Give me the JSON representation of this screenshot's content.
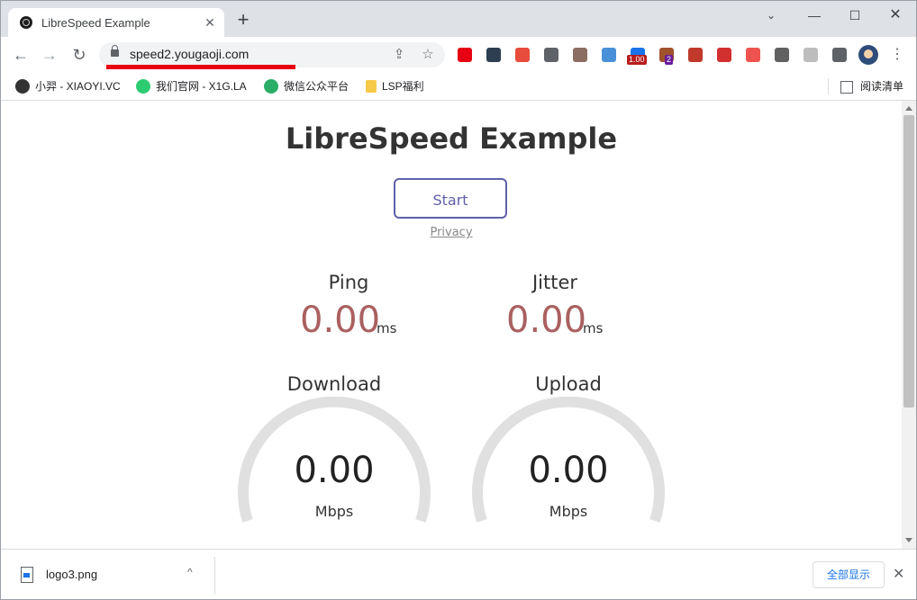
{
  "browser": {
    "tab_title": "LibreSpeed Example",
    "tab_close": "✕",
    "new_tab": "+",
    "tab_search": "⌄",
    "min": "—",
    "max": "☐",
    "close": "✕",
    "back": "←",
    "forward": "→",
    "reload": "↻",
    "url": "speed2.yougaoji.com",
    "share": "⇪",
    "star": "☆",
    "menu": "⋮",
    "extensions": [
      {
        "name": "opera-extension-icon",
        "color": "#e60012"
      },
      {
        "name": "terminal-extension-icon",
        "color": "#2c3e50"
      },
      {
        "name": "redirect-extension-icon",
        "color": "#e74c3c"
      },
      {
        "name": "copy-extension-icon",
        "color": "#5f6368"
      },
      {
        "name": "cookie-extension-icon",
        "color": "#8d6e63"
      },
      {
        "name": "image-extension-icon",
        "color": "#4a90d9"
      },
      {
        "name": "video-speed-extension-icon",
        "color": "#1a73e8",
        "badge": "1.00",
        "badge_color": "#b71c1c"
      },
      {
        "name": "tampermonkey-extension-icon",
        "color": "#a0522d",
        "badge": "2",
        "badge_color": "#6a1b9a"
      },
      {
        "name": "bug-extension-icon",
        "color": "#c0392b"
      },
      {
        "name": "alert-extension-icon",
        "color": "#d32f2f"
      },
      {
        "name": "block-extension-icon",
        "color": "#ef5350"
      },
      {
        "name": "mountain-extension-icon",
        "color": "#616161"
      },
      {
        "name": "screen-extension-icon",
        "color": "#bdbdbd"
      },
      {
        "name": "puzzle-extension-icon",
        "color": "#5f6368"
      }
    ]
  },
  "bookmarks": [
    {
      "label": "小羿 - XIAOYI.VC",
      "icon": "avatar-icon",
      "color": "#333333"
    },
    {
      "label": "我们官网 - X1G.LA",
      "icon": "gear-logo-icon",
      "color": "#2ecc71"
    },
    {
      "label": "微信公众平台",
      "icon": "wechat-icon",
      "color": "#2aae67"
    },
    {
      "label": "LSP福利",
      "icon": "folder-icon",
      "color": "#f7c948"
    }
  ],
  "reading_list": "阅读清单",
  "page": {
    "title": "LibreSpeed Example",
    "start": "Start",
    "privacy": "Privacy",
    "ping_label": "Ping",
    "ping_value": "0.00",
    "ping_unit": "ms",
    "jitter_label": "Jitter",
    "jitter_value": "0.00",
    "jitter_unit": "ms",
    "download_label": "Download",
    "download_value": "0.00",
    "download_unit": "Mbps",
    "upload_label": "Upload",
    "upload_value": "0.00",
    "upload_unit": "Mbps"
  },
  "download_shelf": {
    "filename": "logo3.png",
    "caret": "^",
    "show_all": "全部显示",
    "close": "✕"
  },
  "colors": {
    "accent": "#6060aa",
    "value_red": "#aa6060",
    "gauge_track": "#e0e0e0",
    "url_underline": "#e60012"
  }
}
